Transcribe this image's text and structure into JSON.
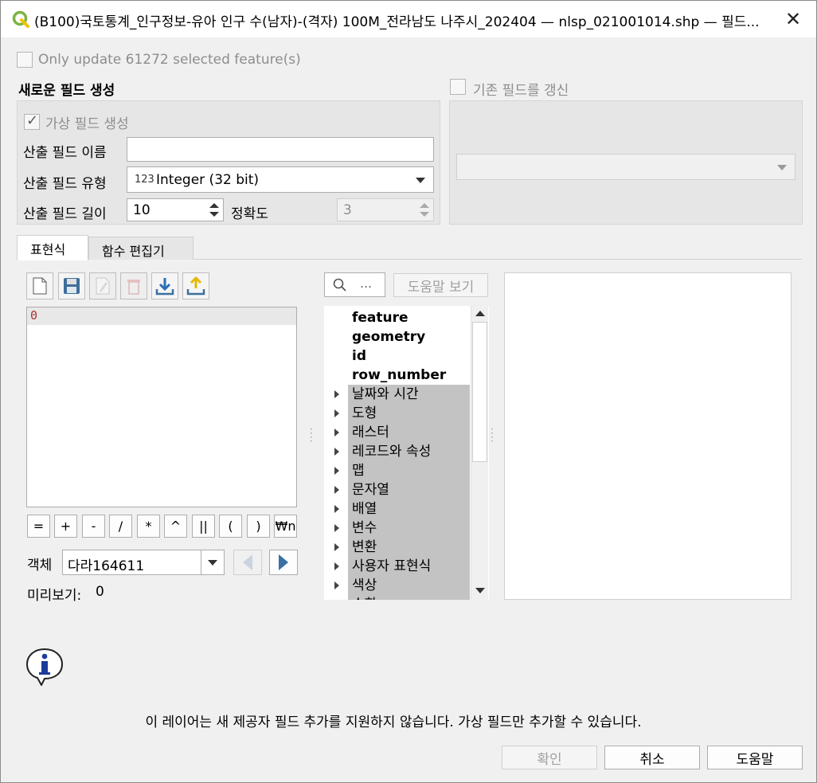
{
  "window": {
    "title": "(B100)국토통계_인구정보-유아 인구 수(남자)-(격자) 100M_전라남도 나주시_202404 — nlsp_021001014.shp — 필드...",
    "close": "✕"
  },
  "options": {
    "only_update_label": "Only update 61272 selected feature(s)"
  },
  "new_field": {
    "heading": "새로운 필드 생성",
    "virtual_label": "가상 필드 생성",
    "name_label": "산출 필드 이름",
    "name_value": "",
    "type_label": "산출 필드 유형",
    "type_icon": "123",
    "type_value": "Integer (32 bit)",
    "length_label": "산출 필드 길이",
    "length_value": "10",
    "precision_label": "정확도",
    "precision_value": "3"
  },
  "update_field": {
    "label": "기존 필드를 갱신"
  },
  "tabs": [
    "표현식",
    "함수 편집기"
  ],
  "expression": {
    "text": "0",
    "operators": [
      "=",
      "+",
      "-",
      "/",
      "*",
      "^",
      "||",
      "(",
      ")",
      "₩n"
    ],
    "feature_label": "객체",
    "feature_value": "다라164611",
    "preview_label": "미리보기:",
    "preview_value": "0"
  },
  "functions": {
    "search_placeholder": "…",
    "help_button": "도움말 보기",
    "items": [
      {
        "label": "feature",
        "type": "bold"
      },
      {
        "label": "geometry",
        "type": "bold"
      },
      {
        "label": "id",
        "type": "bold"
      },
      {
        "label": "row_number",
        "type": "bold"
      },
      {
        "label": "날짜와 시간",
        "type": "group"
      },
      {
        "label": "도형",
        "type": "group"
      },
      {
        "label": "래스터",
        "type": "group"
      },
      {
        "label": "레코드와 속성",
        "type": "group"
      },
      {
        "label": "맵",
        "type": "group"
      },
      {
        "label": "문자열",
        "type": "group"
      },
      {
        "label": "배열",
        "type": "group"
      },
      {
        "label": "변수",
        "type": "group"
      },
      {
        "label": "변환",
        "type": "group"
      },
      {
        "label": "사용자 표현식",
        "type": "group"
      },
      {
        "label": "색상",
        "type": "group"
      },
      {
        "label": "수학",
        "type": "group"
      }
    ]
  },
  "message": {
    "text": "이 레이어는 새 제공자 필드 추가를 지원하지 않습니다. 가상 필드만 추가할 수 있습니다."
  },
  "buttons": {
    "ok": "확인",
    "cancel": "취소",
    "help": "도움말"
  }
}
